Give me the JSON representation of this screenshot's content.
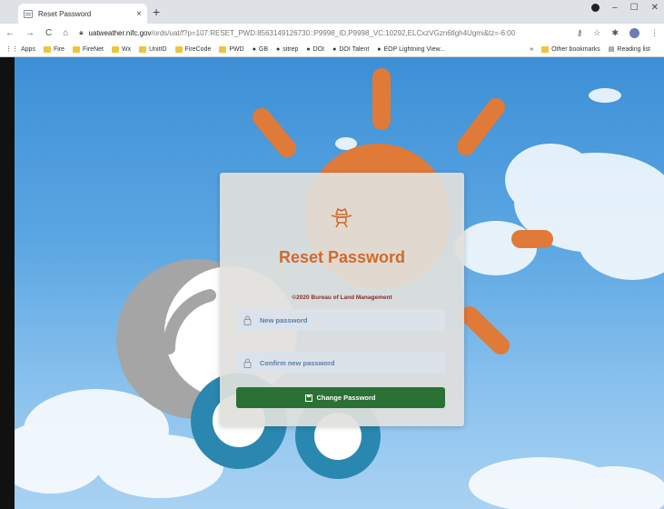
{
  "browser": {
    "tab_title": "Reset Password",
    "tab_close": "×",
    "new_tab": "+",
    "url_host": "uatweather.nifc.gov",
    "url_path": "/ords/uat/f?p=107:RESET_PWD:8563149126730::P9998_ID,P9998_VC:10292,ELCxzVGzn6tlgh4Ugmi&tz=-6:00",
    "bookmarks": [
      {
        "label": "Apps",
        "type": "apps"
      },
      {
        "label": "Fire",
        "type": "folder"
      },
      {
        "label": "FireNet",
        "type": "folder"
      },
      {
        "label": "Wx",
        "type": "folder"
      },
      {
        "label": "UnitID",
        "type": "folder"
      },
      {
        "label": "FireCode",
        "type": "folder"
      },
      {
        "label": "PWD",
        "type": "folder"
      },
      {
        "label": "GB",
        "type": "site"
      },
      {
        "label": "sitrep",
        "type": "site"
      },
      {
        "label": "DOI",
        "type": "site"
      },
      {
        "label": "DOI Talent",
        "type": "site"
      },
      {
        "label": "EOP Lightning View...",
        "type": "site"
      }
    ],
    "bookmarks_overflow": "»",
    "other_bookmarks": "Other bookmarks",
    "reading_list": "Reading list"
  },
  "card": {
    "title": "Reset Password",
    "copyright": "©2020 Bureau of Land Management",
    "new_password_placeholder": "New password",
    "confirm_password_placeholder": "Confirm new password",
    "submit_label": "Change Password"
  },
  "colors": {
    "sun": "#e07a38",
    "cloud_gray": "#a5a5a5",
    "cloud_teal": "#2a87b0",
    "title": "#d06a2a",
    "button": "#2b7035"
  }
}
